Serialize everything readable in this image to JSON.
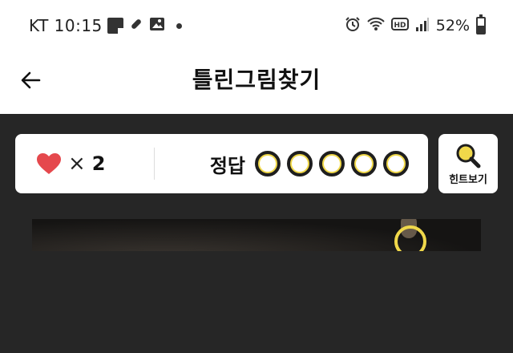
{
  "status_bar": {
    "carrier_time": "KT 10:15",
    "battery_percent": "52%",
    "battery_level": 0.52,
    "icons_left": [
      "note-icon",
      "link-icon",
      "image-icon",
      "dot-icon"
    ],
    "icons_right": [
      "alarm-icon",
      "wifi-icon",
      "hd-icon",
      "signal-icon",
      "battery-icon"
    ]
  },
  "header": {
    "title": "틀린그림찾기",
    "back_icon": "arrow-left-icon"
  },
  "score": {
    "lives_symbol": "×",
    "lives_count": "2",
    "answers_label": "정답",
    "answers_total": 5,
    "answers_found": 0
  },
  "hint": {
    "label": "힌트보기",
    "icon": "magnifier-icon"
  },
  "colors": {
    "background": "#262626",
    "accent": "#f0d84a",
    "heart": "#e5484d"
  }
}
